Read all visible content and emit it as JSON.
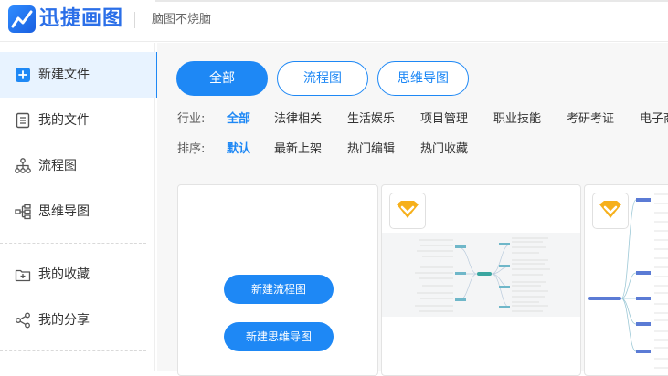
{
  "header": {
    "app_name": "迅捷画图",
    "slogan": "脑图不烧脑",
    "logo_icon": "chart-line-logo-icon"
  },
  "sidebar": {
    "items": [
      {
        "label": "新建文件",
        "icon": "plus-square-icon",
        "active": true
      },
      {
        "label": "我的文件",
        "icon": "document-icon",
        "active": false
      },
      {
        "label": "流程图",
        "icon": "flowchart-icon",
        "active": false
      },
      {
        "label": "思维导图",
        "icon": "mindmap-icon",
        "active": false
      },
      {
        "label": "我的收藏",
        "icon": "favorite-folder-icon",
        "active": false
      },
      {
        "label": "我的分享",
        "icon": "share-icon",
        "active": false
      }
    ]
  },
  "tabs": [
    {
      "label": "全部",
      "active": true
    },
    {
      "label": "流程图",
      "active": false
    },
    {
      "label": "思维导图",
      "active": false
    }
  ],
  "filters": {
    "industry_label": "行业:",
    "industry_options": [
      "全部",
      "法律相关",
      "生活娱乐",
      "项目管理",
      "职业技能",
      "考研考证",
      "电子商"
    ],
    "sort_label": "排序:",
    "sort_options": [
      "默认",
      "最新上架",
      "热门编辑",
      "热门收藏"
    ]
  },
  "cards": {
    "new_flowchart_label": "新建流程图",
    "new_mindmap_label": "新建思维导图",
    "badge_icon": "vip-crown-icon"
  },
  "colors": {
    "accent": "#1e88f5",
    "badge": "#f6b01b"
  }
}
